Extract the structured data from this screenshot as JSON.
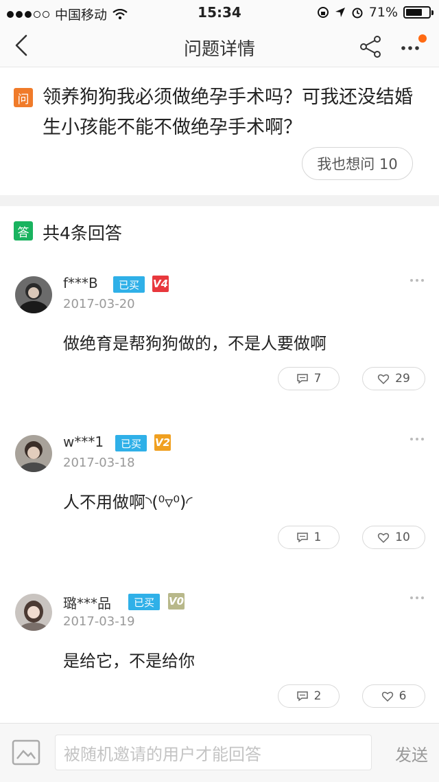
{
  "status_bar": {
    "carrier": "中国移动",
    "time": "15:34",
    "battery_percent": "71%",
    "battery_level": 0.71,
    "signal_icon": "signal-dots",
    "wifi_icon": "wifi-icon",
    "lock_icon": "rotation-lock-icon",
    "location_icon": "location-icon",
    "alarm_icon": "alarm-icon"
  },
  "nav": {
    "title": "问题详情",
    "back_icon": "chevron-left-icon",
    "share_icon": "share-icon",
    "more_icon": "more-dots-icon",
    "accent_color": "#ff6a13"
  },
  "question": {
    "icon_label": "问",
    "text": "领养狗狗我必须做绝孕手术吗？可我还没结婚生小孩能不能不做绝孕手术啊？",
    "ask_too_label": "我也想问 10",
    "icon_color": "#f07b2a"
  },
  "answers_header": {
    "icon_label": "答",
    "count_text": "共4条回答",
    "icon_color": "#19b35f"
  },
  "answers": [
    {
      "username": "f***B",
      "bought_tag": "已买",
      "level": "V4",
      "level_color": "#e8383d",
      "date": "2017-03-20",
      "content": "做绝育是帮狗狗做的，不是人要做啊",
      "comments": "7",
      "likes": "29"
    },
    {
      "username": "w***1",
      "bought_tag": "已买",
      "level": "V2",
      "level_color": "#f0a020",
      "date": "2017-03-18",
      "content": "人不用做啊◝(⁰▿⁰)◜",
      "comments": "1",
      "likes": "10"
    },
    {
      "username": "璐***品",
      "bought_tag": "已买",
      "level": "V0",
      "level_color": "#b8b88a",
      "date": "2017-03-19",
      "content": "是给它，不是给你",
      "comments": "2",
      "likes": "6"
    }
  ],
  "bottom_bar": {
    "image_icon": "image-icon",
    "placeholder": "被随机邀请的用户才能回答",
    "send_label": "发送"
  }
}
